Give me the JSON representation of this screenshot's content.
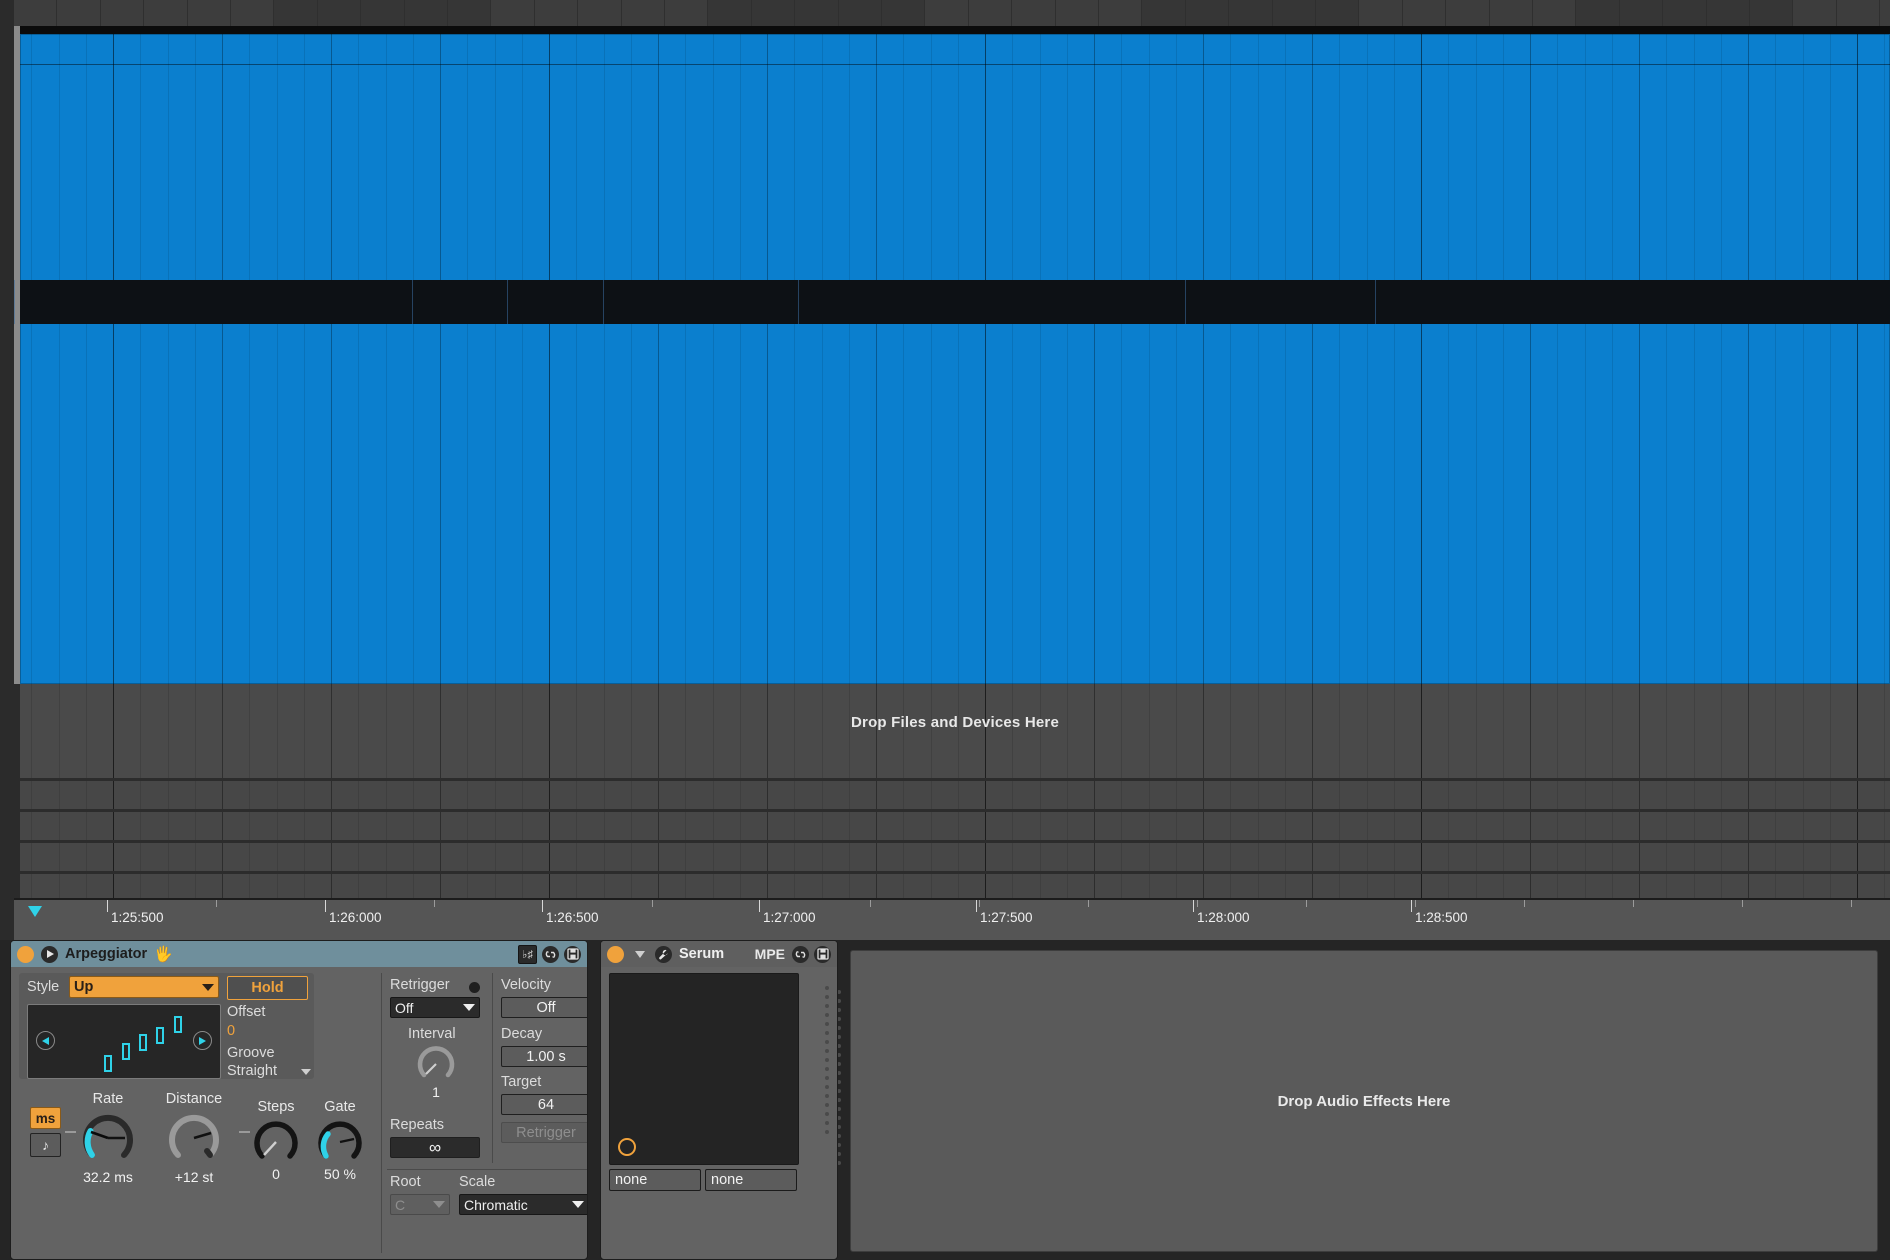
{
  "arrangement": {
    "clip_color": "#0b7fce",
    "drop_files_label": "Drop Files and Devices Here",
    "grid_resolution": "1/32",
    "timeline": {
      "labels": [
        "1:25:500",
        "1:26:000",
        "1:26:500",
        "1:27:000",
        "1:27:500",
        "1:28:000",
        "1:28:500"
      ],
      "positions": [
        93,
        311,
        528,
        745,
        962,
        1179,
        1397
      ]
    }
  },
  "devices": {
    "arpeggiator": {
      "title": "Arpeggiator",
      "hand_icon": "hand-icon",
      "power_icon": "power-toggle-icon",
      "play_icon": "play-icon",
      "header_buttons": [
        "flat-sharp-icon",
        "midi-map-icon",
        "save-preset-icon"
      ],
      "flat_sharp_label": "♭♯",
      "style_label": "Style",
      "style_value": "Up",
      "hold_label": "Hold",
      "offset_label": "Offset",
      "offset_value": "0",
      "groove_label": "Groove",
      "groove_value": "Straight",
      "knobs": [
        {
          "name": "Rate",
          "value": "32.2 ms"
        },
        {
          "name": "Distance",
          "value": "+12 st"
        },
        {
          "name": "Steps",
          "value": "0"
        },
        {
          "name": "Gate",
          "value": "50 %"
        }
      ],
      "ms_button": "ms",
      "note_button": "♪",
      "retrigger_label": "Retrigger",
      "retrigger_value": "Off",
      "interval_label": "Interval",
      "interval_value": "1",
      "repeats_label": "Repeats",
      "repeats_value": "∞",
      "velocity_label": "Velocity",
      "velocity_value": "Off",
      "decay_label": "Decay",
      "decay_value": "1.00 s",
      "target_label": "Target",
      "target_value": "64",
      "retrigger_button": "Retrigger",
      "root_label": "Root",
      "root_value": "C",
      "scale_label": "Scale",
      "scale_value": "Chromatic",
      "accent_color": "#f0a23c",
      "note_color": "#2fd2e8"
    },
    "serum": {
      "title": "Serum",
      "mpe_label": "MPE",
      "power_icon": "power-toggle-icon",
      "fold_icon": "chevron-down-icon",
      "wrench_icon": "wrench-icon",
      "header_buttons": [
        "midi-map-icon",
        "save-preset-icon"
      ],
      "macro_left": "none",
      "macro_right": "none"
    },
    "drop_audio_effects_label": "Drop Audio Effects Here"
  }
}
